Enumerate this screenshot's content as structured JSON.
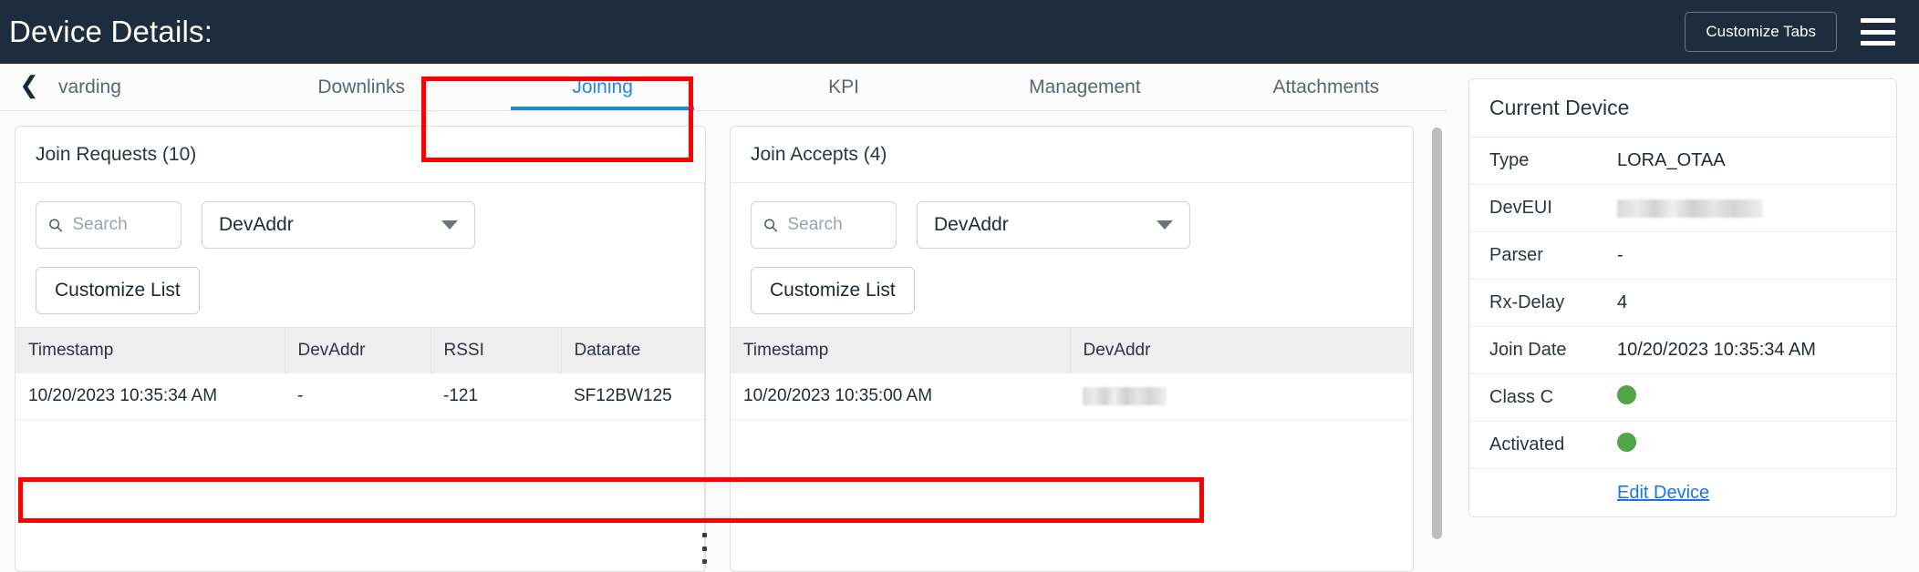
{
  "header": {
    "title": "Device Details:",
    "customize_tabs_label": "Customize Tabs",
    "menu_icon": "hamburger-icon"
  },
  "tabs": {
    "back_icon": "chevron-left-icon",
    "items": [
      {
        "label": "varding",
        "active": false
      },
      {
        "label": "Downlinks",
        "active": false
      },
      {
        "label": "Joining",
        "active": true
      },
      {
        "label": "KPI",
        "active": false
      },
      {
        "label": "Management",
        "active": false
      },
      {
        "label": "Attachments",
        "active": false
      }
    ]
  },
  "join_requests": {
    "title": "Join Requests (10)",
    "search": {
      "value": "",
      "placeholder": "Search",
      "icon": "search-icon"
    },
    "filter": {
      "value": "DevAddr",
      "icon": "chevron-down-icon"
    },
    "customize_list_label": "Customize List",
    "columns": [
      "Timestamp",
      "DevAddr",
      "RSSI",
      "Datarate"
    ],
    "rows": [
      {
        "timestamp": "10/20/2023 10:35:34 AM",
        "devaddr": "-",
        "rssi": "-121",
        "datarate": "SF12BW125"
      }
    ]
  },
  "join_accepts": {
    "title": "Join Accepts (4)",
    "search": {
      "value": "",
      "placeholder": "Search",
      "icon": "search-icon"
    },
    "filter": {
      "value": "DevAddr",
      "icon": "chevron-down-icon"
    },
    "customize_list_label": "Customize List",
    "columns": [
      "Timestamp",
      "DevAddr"
    ],
    "rows": [
      {
        "timestamp": "10/20/2023 10:35:00 AM",
        "devaddr": ""
      }
    ]
  },
  "current_device": {
    "title": "Current Device",
    "rows": [
      {
        "label": "Type",
        "value": "LORA_OTAA",
        "kind": "text"
      },
      {
        "label": "DevEUI",
        "value": "",
        "kind": "redacted"
      },
      {
        "label": "Parser",
        "value": "-",
        "kind": "text"
      },
      {
        "label": "Rx-Delay",
        "value": "4",
        "kind": "text"
      },
      {
        "label": "Join Date",
        "value": "10/20/2023 10:35:34 AM",
        "kind": "text"
      },
      {
        "label": "Class C",
        "value": "",
        "kind": "status-dot"
      },
      {
        "label": "Activated",
        "value": "",
        "kind": "status-dot"
      }
    ],
    "edit_link_label": "Edit Device"
  },
  "colors": {
    "topbar_bg": "#1e2d3d",
    "accent_blue": "#1e88e5",
    "link_blue": "#1a73e8",
    "status_green": "#52a447",
    "annotation_red": "#ff0000",
    "table_header_bg": "#eeeeee"
  }
}
